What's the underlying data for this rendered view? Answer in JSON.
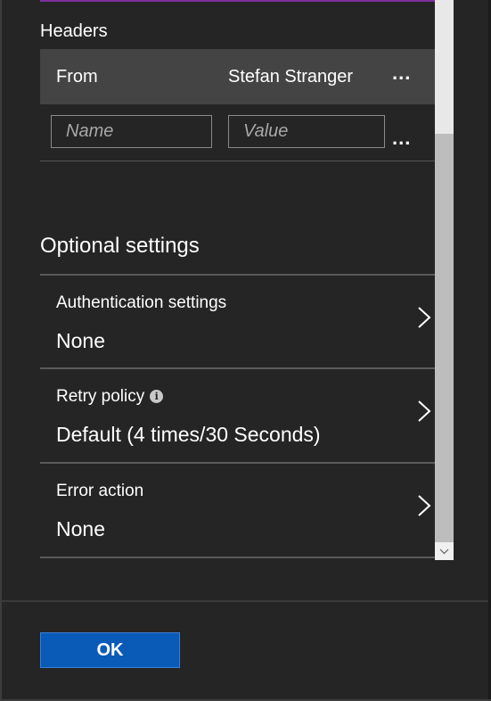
{
  "headers": {
    "section_label": "Headers",
    "rows": [
      {
        "name": "From",
        "value": "Stefan Stranger",
        "more": "..."
      }
    ],
    "new_row": {
      "name_placeholder": "Name",
      "value_placeholder": "Value",
      "more": "..."
    }
  },
  "optional": {
    "heading": "Optional settings",
    "items": [
      {
        "label": "Authentication settings",
        "value": "None"
      },
      {
        "label": "Retry policy",
        "value": "Default (4 times/30 Seconds)",
        "info_icon": "i"
      },
      {
        "label": "Error action",
        "value": "None"
      }
    ]
  },
  "footer": {
    "ok_label": "OK"
  },
  "colors": {
    "background": "#252525",
    "header_row": "#444444",
    "accent": "#7f2fa0",
    "ok_button": "#0a5ab8"
  },
  "icons": [
    "more-ellipsis-icon",
    "chevron-right-icon",
    "info-icon",
    "scroll-down-arrow-icon"
  ]
}
